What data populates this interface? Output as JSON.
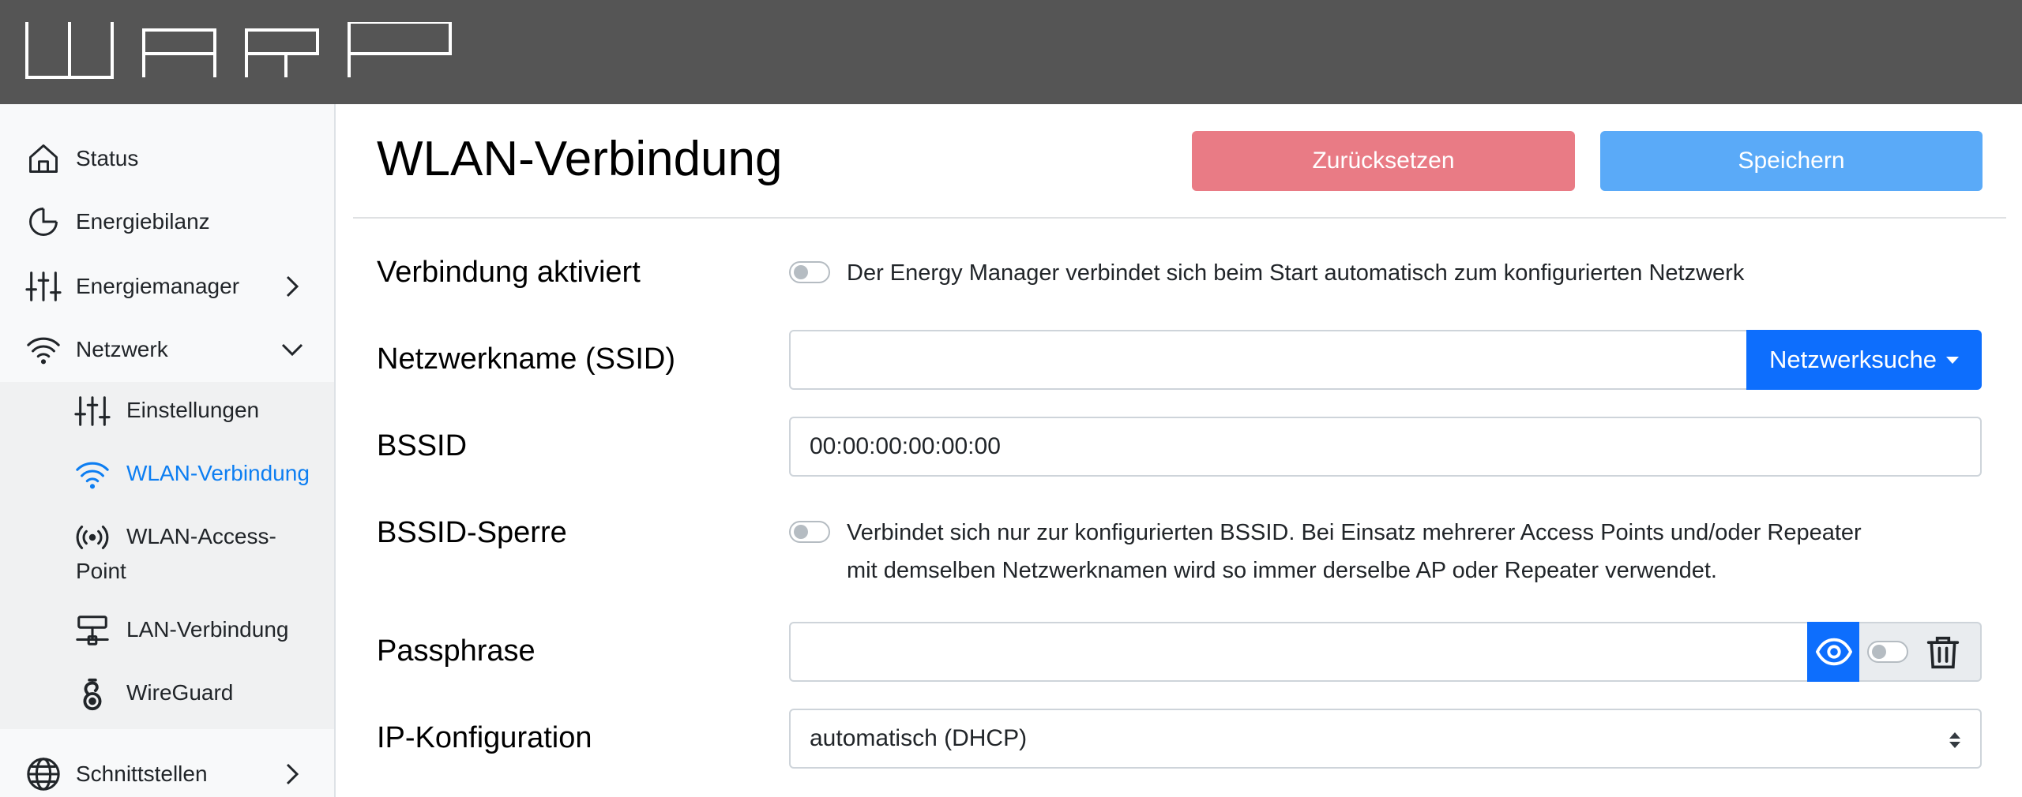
{
  "header": {
    "logo_name": "warp-logo",
    "colors": {
      "background": "#555555"
    }
  },
  "sidebar": {
    "items": [
      {
        "label": "Status",
        "icon": "home-icon"
      },
      {
        "label": "Energiebilanz",
        "icon": "pie-chart-icon"
      },
      {
        "label": "Energiemanager",
        "icon": "sliders-icon",
        "chevron": "chevron-right-icon"
      },
      {
        "label": "Netzwerk",
        "icon": "wifi-icon",
        "chevron": "chevron-down-icon",
        "expanded": true
      },
      {
        "label": "Schnittstellen",
        "icon": "globe-icon",
        "chevron": "chevron-right-icon"
      }
    ],
    "subitems": [
      {
        "label": "Einstellungen",
        "icon": "sliders-icon"
      },
      {
        "label": "WLAN-Verbindung",
        "icon": "wifi-icon",
        "active": true
      },
      {
        "label_line1": "WLAN-Access-",
        "label_line2": "Point",
        "icon": "broadcast-icon"
      },
      {
        "label": "LAN-Verbindung",
        "icon": "ethernet-icon"
      },
      {
        "label": "WireGuard",
        "icon": "wireguard-icon"
      }
    ]
  },
  "main": {
    "title": "WLAN-Verbindung",
    "reset_label": "Zurücksetzen",
    "save_label": "Speichern",
    "rows": {
      "enabled": {
        "label": "Verbindung aktiviert",
        "help": "Der Energy Manager verbindet sich beim Start automatisch zum konfigurierten Netzwerk",
        "checked": false
      },
      "ssid": {
        "label": "Netzwerkname (SSID)",
        "value": "",
        "scan_label": "Netzwerksuche"
      },
      "bssid": {
        "label": "BSSID",
        "value": "00:00:00:00:00:00"
      },
      "bssid_lock": {
        "label": "BSSID-Sperre",
        "help_line1": "Verbindet sich nur zur konfigurierten BSSID. Bei Einsatz mehrerer Access Points und/oder Repeater",
        "help_line2": "mit demselben Netzwerknamen wird so immer derselbe AP oder Repeater verwendet.",
        "checked": false
      },
      "passphrase": {
        "label": "Passphrase",
        "value": ""
      },
      "ip_config": {
        "label": "IP-Konfiguration",
        "selected": "automatisch (DHCP)"
      }
    }
  },
  "colors": {
    "primary": "#0d6efd",
    "active_link": "#0d7ef2",
    "reset_button": "#e97b85",
    "save_button": "#5aaaf8"
  }
}
